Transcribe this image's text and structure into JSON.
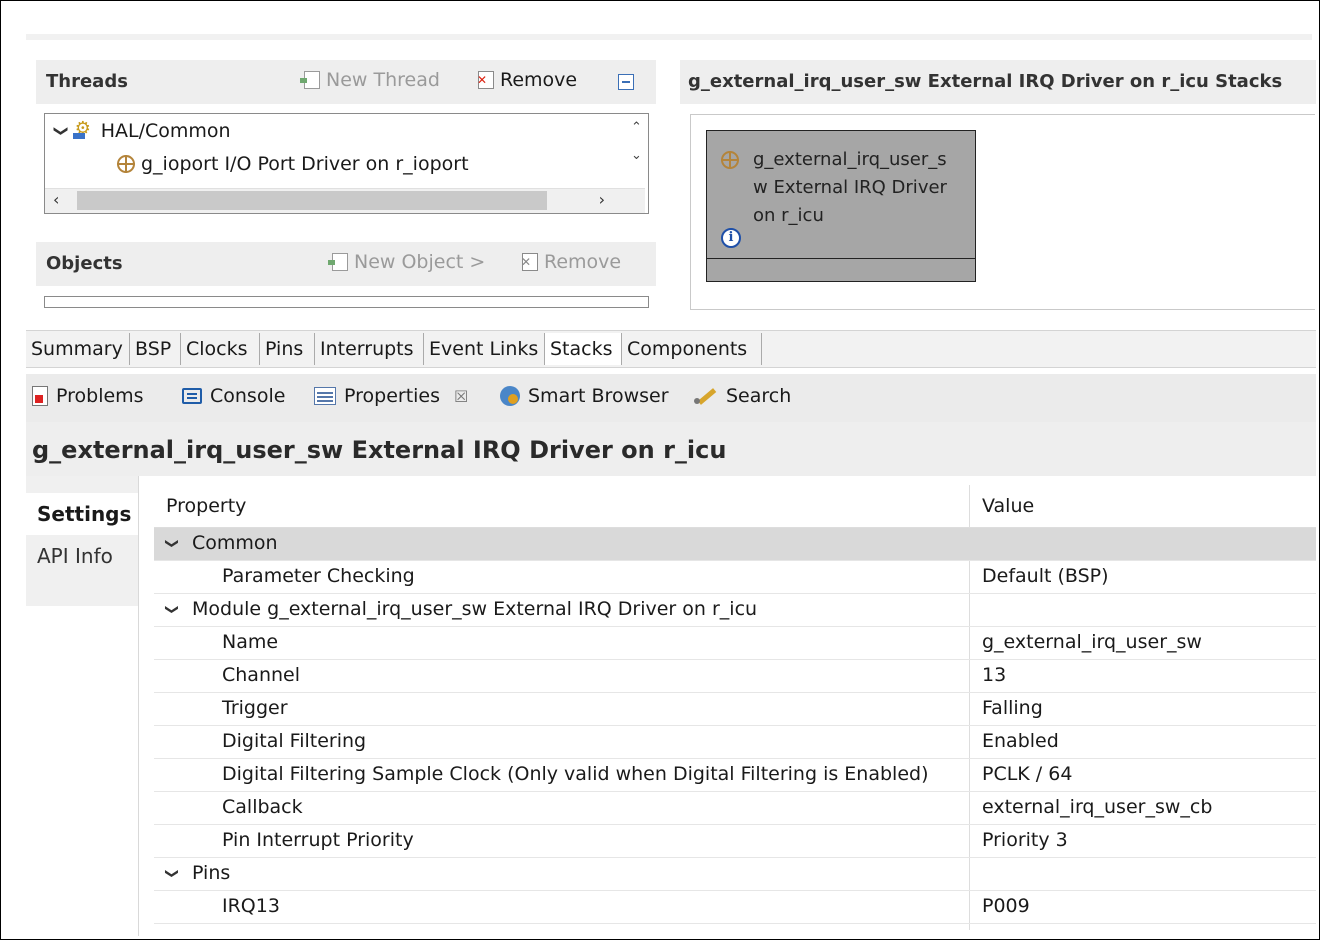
{
  "threads": {
    "title": "Threads",
    "new_thread": "New Thread",
    "remove": "Remove",
    "tree": [
      {
        "label": "HAL/Common"
      },
      {
        "label": "g_ioport I/O Port Driver on r_ioport"
      }
    ]
  },
  "objects": {
    "title": "Objects",
    "new_object": "New Object >",
    "remove": "Remove"
  },
  "stacks": {
    "title": "g_external_irq_user_sw External IRQ Driver on r_icu Stacks",
    "module_line1": "g_external_irq_user_s",
    "module_line2": "w External IRQ Driver",
    "module_line3": "on r_icu",
    "info_glyph": "i"
  },
  "editor_tabs": [
    "Summary",
    "BSP",
    "Clocks",
    "Pins",
    "Interrupts",
    "Event Links",
    "Stacks",
    "Components"
  ],
  "views": {
    "problems": "Problems",
    "console": "Console",
    "properties": "Properties",
    "close_glyph": "☒",
    "smart_browser": "Smart Browser",
    "search": "Search"
  },
  "properties": {
    "title": "g_external_irq_user_sw External IRQ Driver on r_icu",
    "tabs": {
      "settings": "Settings",
      "api_info": "API Info"
    },
    "header": {
      "property": "Property",
      "value": "Value"
    },
    "rows": [
      {
        "key": "Common",
        "value": ""
      },
      {
        "key": "Parameter Checking",
        "value": "Default (BSP)"
      },
      {
        "key": "Module g_external_irq_user_sw External IRQ Driver on r_icu",
        "value": ""
      },
      {
        "key": "Name",
        "value": "g_external_irq_user_sw"
      },
      {
        "key": "Channel",
        "value": "13"
      },
      {
        "key": "Trigger",
        "value": "Falling"
      },
      {
        "key": "Digital Filtering",
        "value": "Enabled"
      },
      {
        "key": "Digital Filtering Sample Clock (Only valid when Digital Filtering is Enabled)",
        "value": "PCLK / 64"
      },
      {
        "key": "Callback",
        "value": "external_irq_user_sw_cb"
      },
      {
        "key": "Pin Interrupt Priority",
        "value": "Priority 3"
      },
      {
        "key": "Pins",
        "value": ""
      },
      {
        "key": "IRQ13",
        "value": "P009"
      }
    ]
  },
  "colors": {
    "stack_block": "#a6a6a6",
    "selected_row": "#d9d9d9",
    "panel_header": "#eeeeee"
  }
}
